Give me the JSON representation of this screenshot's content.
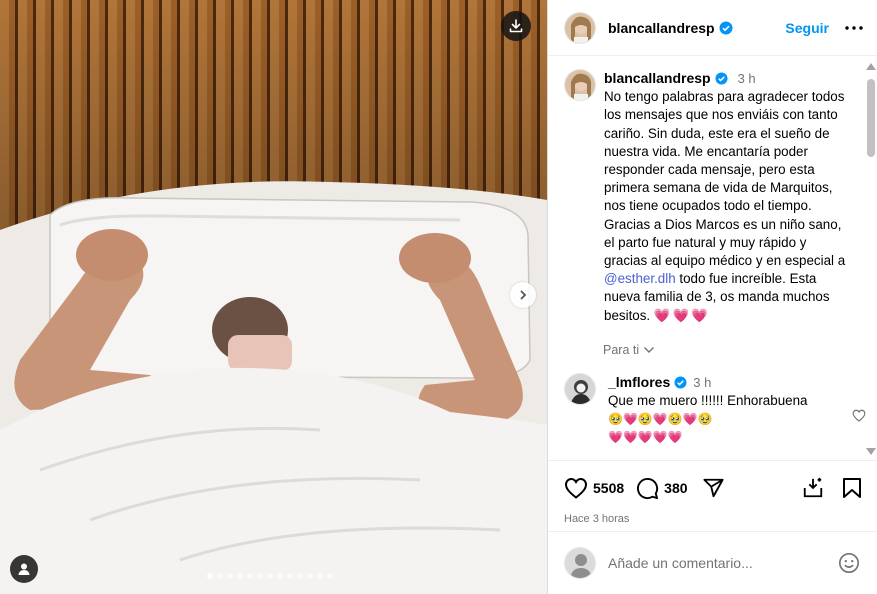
{
  "post": {
    "username": "blancallandresp",
    "follow_label": "Seguir",
    "caption_time": "3 h",
    "caption_text_1": "No tengo palabras para agradecer todos los mensajes que nos enviáis con tanto cariño. Sin duda, este era el sueño de nuestra vida. Me encantaría poder responder cada mensaje, pero esta primera semana de vida de Marquitos, nos tiene ocupados todo el tiempo. Gracias a Dios Marcos es un niño sano, el parto fue natural y muy rápido y gracias al equipo médico y en especial a ",
    "caption_mention": "@esther.dlh",
    "caption_text_2": " todo fue increíble. Esta nueva familia de 3, os manda muchos besitos. ",
    "caption_hearts": "💗💗💗",
    "translate_label": "Para ti",
    "likes": "5508",
    "comments_count": "380",
    "posted_ago": "Hace 3 horas"
  },
  "comment": {
    "username": "_lmflores",
    "time": "3 h",
    "text": "Que me muero !!!!!! Enhorabuena",
    "emojis_1": "🥹💗🥹💗🥹💗🥹",
    "emojis_2": "💗💗💗💗💗"
  },
  "add_comment": {
    "placeholder": "Añade un comentario..."
  },
  "carousel": {
    "total": 13,
    "active": 0
  },
  "colors": {
    "accent": "#0095f6",
    "verified": "#0095f6",
    "secondary_text": "#737373"
  },
  "icons": [
    "download-icon",
    "chevron-right-icon",
    "user-tag-icon",
    "verified-icon",
    "more-icon",
    "heart-icon",
    "comment-icon",
    "share-icon",
    "save-to-collection-icon",
    "bookmark-icon",
    "emoji-icon",
    "chevron-down-icon"
  ]
}
